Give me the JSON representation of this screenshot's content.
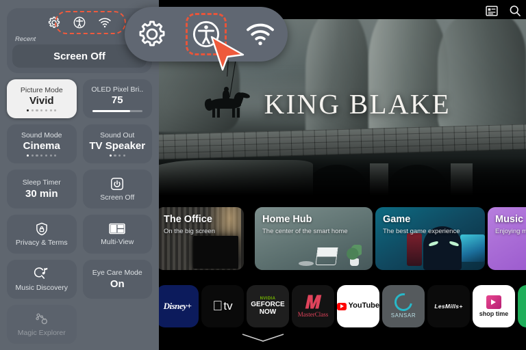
{
  "quick_settings": {
    "panel_name": "Quick Settings",
    "top_icons": [
      {
        "name": "all-settings-icon",
        "label": "All Settings"
      },
      {
        "name": "accessibility-icon",
        "label": "Accessibility"
      },
      {
        "name": "wifi-icon",
        "label": "Network"
      }
    ],
    "recent_label": "Recent",
    "recent_item": "Screen Off",
    "highlight_color": "#ef5a3d",
    "tiles": [
      {
        "label": "Picture Mode",
        "value": "Vivid",
        "selected": true,
        "dots": 7,
        "active_dot": 0
      },
      {
        "label": "OLED Pixel Bri..",
        "value": "75",
        "selected": false,
        "progress": 75
      },
      {
        "label": "Sound Mode",
        "value": "Cinema",
        "selected": false,
        "dots": 7,
        "active_dot": 0
      },
      {
        "label": "Sound Out",
        "value": "TV Speaker",
        "selected": false,
        "dots": 4,
        "active_dot": 0
      },
      {
        "label": "Sleep Timer",
        "value": "30 min",
        "selected": false
      },
      {
        "label": "Screen Off",
        "value": "",
        "icon": "power-icon",
        "selected": false
      },
      {
        "label": "Privacy & Terms",
        "value": "",
        "icon": "shield-lock-icon",
        "selected": false
      },
      {
        "label": "Multi-View",
        "value": "",
        "icon": "multiview-icon",
        "selected": false
      },
      {
        "label": "Music Discovery",
        "value": "",
        "icon": "music-search-icon",
        "selected": false
      },
      {
        "label": "Eye Care Mode",
        "value": "On",
        "selected": false
      },
      {
        "label": "Magic Explorer",
        "value": "",
        "icon": "magic-explorer-icon",
        "selected": false,
        "disabled": true
      }
    ]
  },
  "callout": {
    "name": "zoomed-quick-settings-icons",
    "icons": [
      {
        "name": "all-settings-icon",
        "label": "All Settings",
        "highlighted": false
      },
      {
        "name": "accessibility-icon",
        "label": "Accessibility",
        "highlighted": true
      },
      {
        "name": "wifi-icon",
        "label": "Network",
        "highlighted": false
      }
    ],
    "cursor": {
      "name": "mouse-cursor",
      "color": "#ee5a3c"
    }
  },
  "topbar": {
    "icons": [
      {
        "name": "guide-icon",
        "label": "Guide"
      },
      {
        "name": "search-icon",
        "label": "Search"
      }
    ]
  },
  "hero": {
    "title": "KING BLAKE",
    "name": "featured-content-banner"
  },
  "cards": [
    {
      "title": "The Office",
      "subtitle": "On the big screen",
      "theme": "office"
    },
    {
      "title": "Home Hub",
      "subtitle": "The center of the smart home",
      "theme": "hub"
    },
    {
      "title": "Game",
      "subtitle": "The best game experience",
      "theme": "game"
    },
    {
      "title": "Music",
      "subtitle": "Enjoying music",
      "theme": "music"
    }
  ],
  "apps": [
    {
      "name": "disney-plus",
      "label": "Disney+",
      "bg": "#0c1b5c",
      "fg": "#ffffff"
    },
    {
      "name": "apple-tv",
      "label": "tv",
      "bg": "#0a0a0a",
      "fg": "#ffffff"
    },
    {
      "name": "geforce-now",
      "label": "GEFORCE NOW",
      "sub": "NVIDIA",
      "bg": "#1e1e1e",
      "fg": "#ffffff"
    },
    {
      "name": "masterclass",
      "label": "MasterClass",
      "bg": "#131313",
      "fg": "#e0435b"
    },
    {
      "name": "youtube",
      "label": "YouTube",
      "bg": "#ffffff",
      "fg": "#0a0a0a"
    },
    {
      "name": "sansar",
      "label": "SANSAR",
      "bg": "#555a5d",
      "fg": "#28b8c8"
    },
    {
      "name": "lesmills-plus",
      "label": "LesMills+",
      "bg": "#0b0b0b",
      "fg": "#ffffff"
    },
    {
      "name": "shop-time",
      "label": "shop time",
      "bg": "#ffffff",
      "fg": "#d1377e"
    },
    {
      "name": "partial-app",
      "label": "",
      "bg": "#1fae5a",
      "fg": "#ffffff"
    }
  ],
  "bottom_indicator": {
    "name": "chevron-down-icon",
    "label": "More"
  }
}
